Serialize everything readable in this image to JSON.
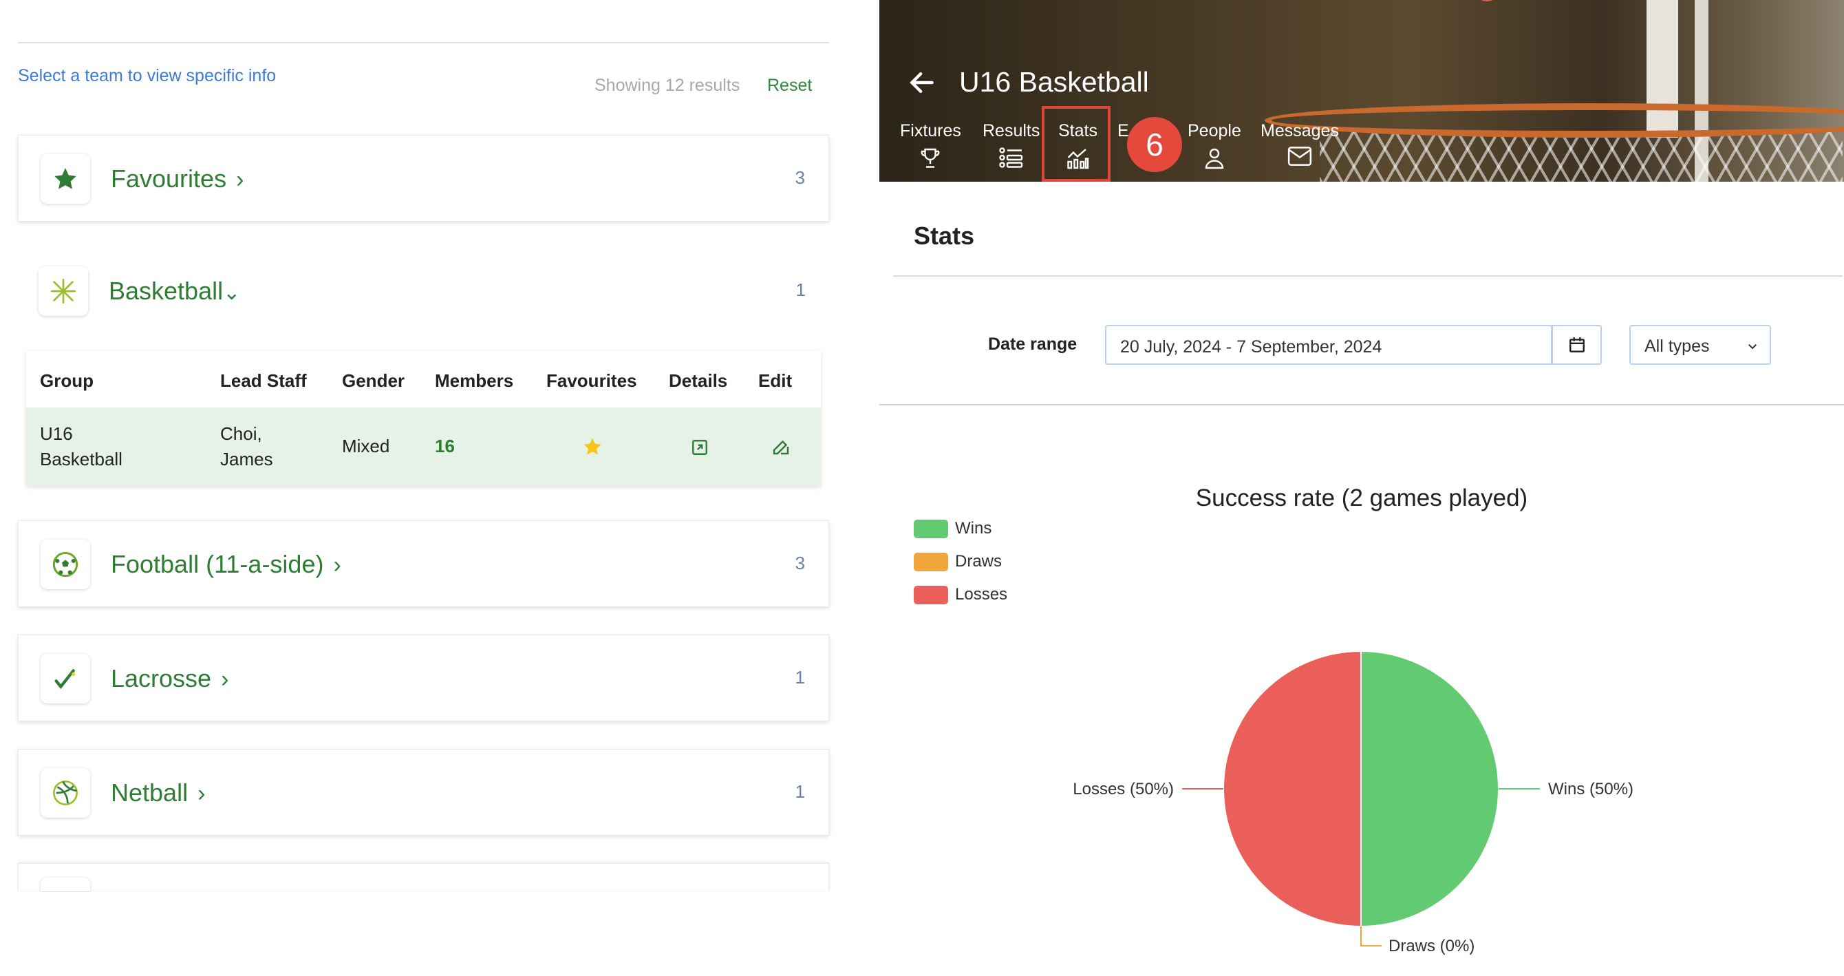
{
  "left": {
    "select_team": "Select a team to view specific info",
    "showing": "Showing 12 results",
    "reset": "Reset",
    "groups": [
      {
        "name": "Favourites",
        "count": "3",
        "icon": "star-icon"
      },
      {
        "name": "Basketball",
        "count": "1",
        "icon": "basketball-icon"
      },
      {
        "name": "Football (11-a-side)",
        "count": "3",
        "icon": "football-icon"
      },
      {
        "name": "Lacrosse",
        "count": "1",
        "icon": "lacrosse-icon"
      },
      {
        "name": "Netball",
        "count": "1",
        "icon": "netball-icon"
      }
    ],
    "table": {
      "headers": [
        "Group",
        "Lead Staff",
        "Gender",
        "Members",
        "Favourites",
        "Details",
        "Edit"
      ],
      "row": {
        "group_line1": "U16",
        "group_line2": "Basketball",
        "staff_line1": "Choi,",
        "staff_line2": "James",
        "gender": "Mixed",
        "members": "16"
      }
    }
  },
  "right": {
    "title": "U16 Basketball",
    "tabs": [
      "Fixtures",
      "Results",
      "Stats",
      "E",
      "People",
      "Messages"
    ],
    "active_tab": "Stats",
    "step_badge": "6",
    "section_title": "Stats",
    "date_label": "Date range",
    "date_value": "20 July, 2024 - 7 September, 2024",
    "type_value": "All types"
  },
  "colors": {
    "brand_green": "#2f7d34",
    "link_blue": "#3b7bd8",
    "wins": "#62cb72",
    "draws": "#f0a63c",
    "losses": "#ea5f59",
    "highlight_red": "#e0473b"
  },
  "chart_data": {
    "type": "pie",
    "title": "Success rate (2 games played)",
    "legend_position": "top-left",
    "categories": [
      "Wins",
      "Draws",
      "Losses"
    ],
    "values": [
      50,
      0,
      50
    ],
    "labels": [
      "Wins (50%)",
      "Draws (0%)",
      "Losses (50%)"
    ]
  }
}
